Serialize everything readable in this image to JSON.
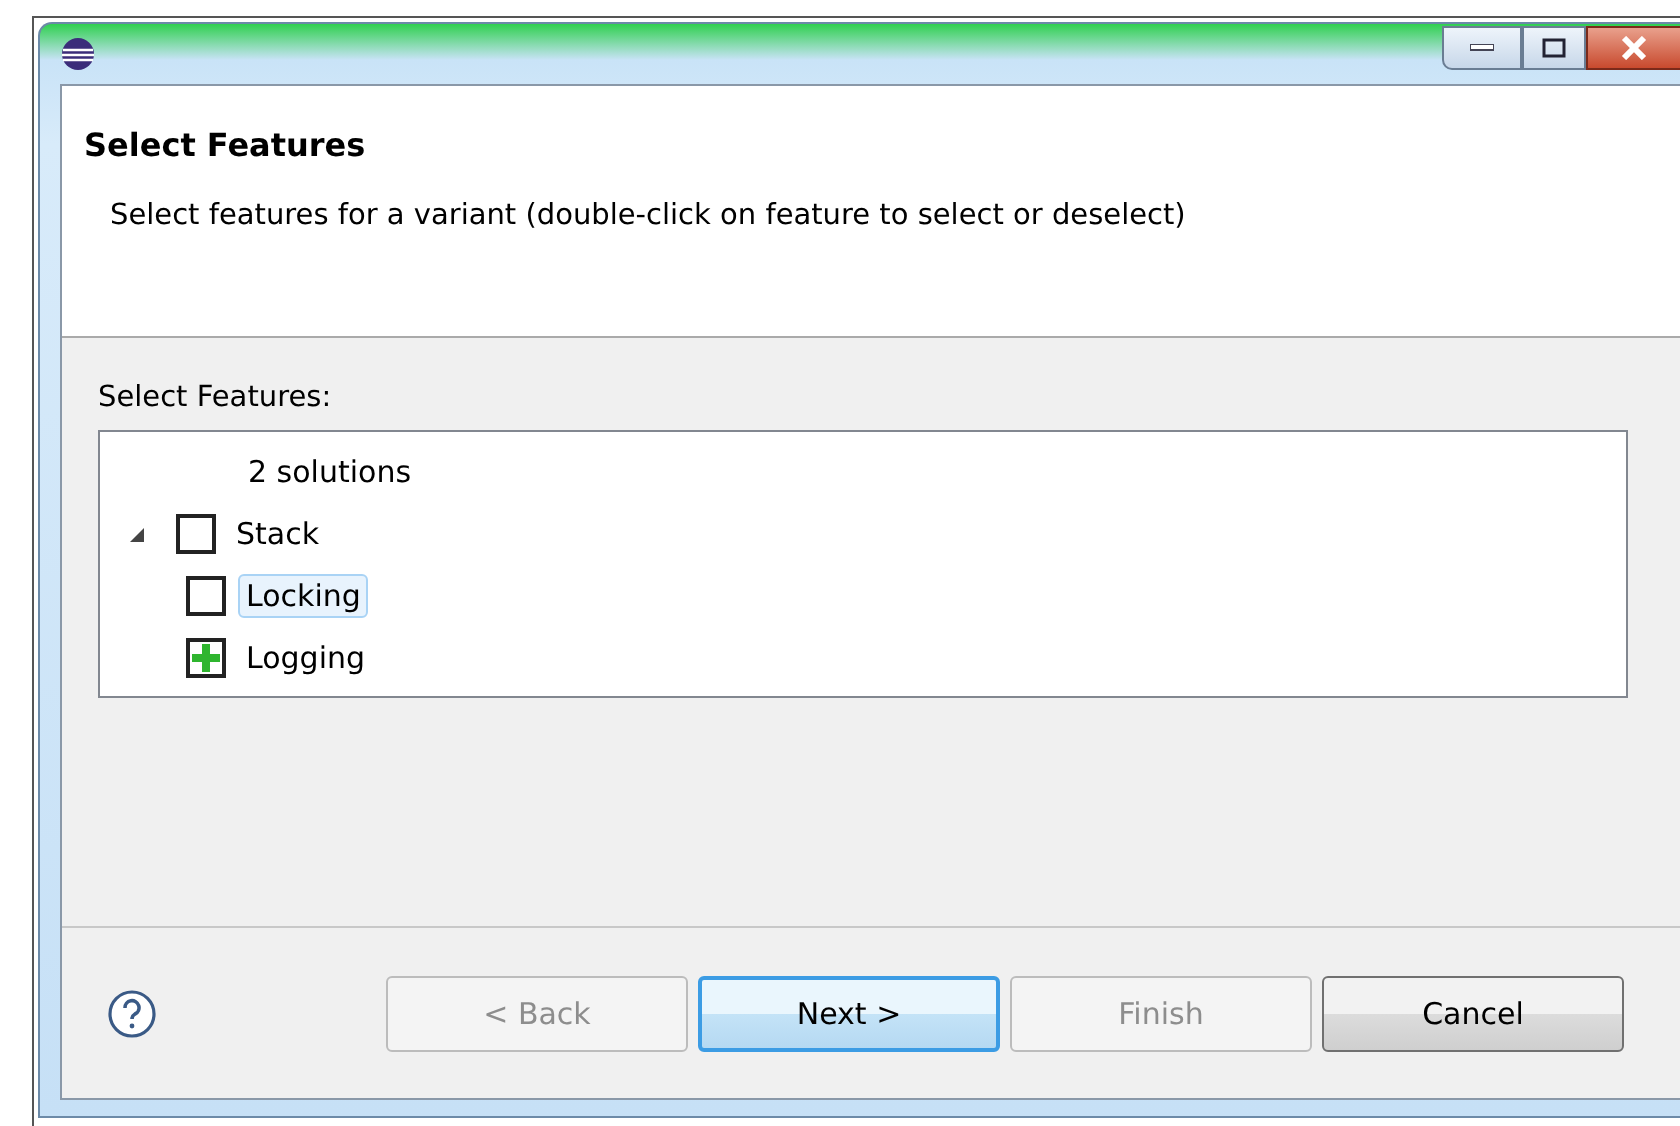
{
  "header": {
    "title": "Select Features",
    "description": "Select features for a variant (double-click on feature to select or deselect)"
  },
  "features_label": "Select Features:",
  "tree": {
    "summary": "2 solutions",
    "items": [
      {
        "label": "Stack",
        "checked": false,
        "expanded": true,
        "selected": false,
        "children": [
          {
            "label": "Locking",
            "checked": false,
            "selected": true
          },
          {
            "label": "Logging",
            "checked": true,
            "selected": false
          }
        ]
      }
    ]
  },
  "buttons": [
    {
      "label": "< Back",
      "disabled": true,
      "default": false
    },
    {
      "label": "Next >",
      "disabled": false,
      "default": true
    },
    {
      "label": "Finish",
      "disabled": true,
      "default": false
    },
    {
      "label": "Cancel",
      "disabled": false,
      "default": false
    }
  ]
}
